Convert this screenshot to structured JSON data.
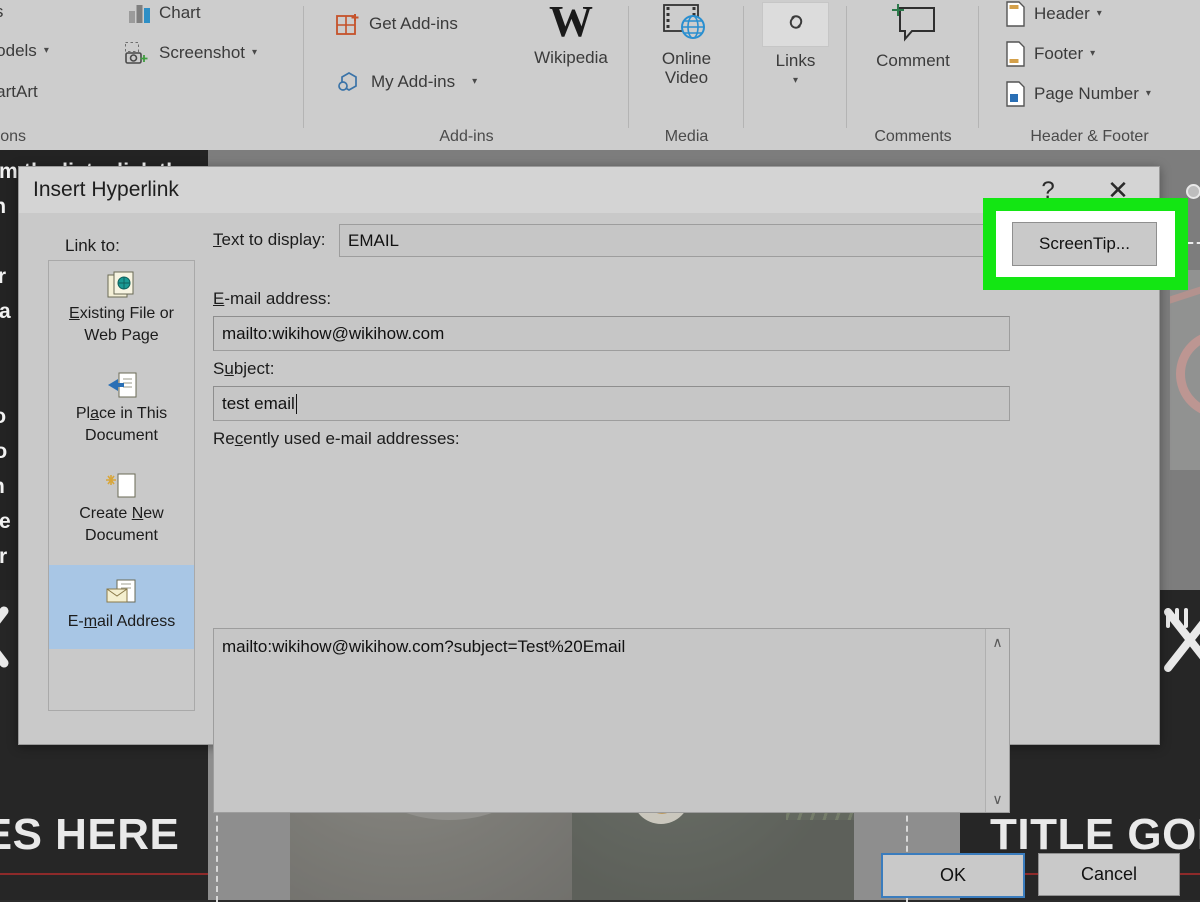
{
  "ribbon": {
    "groups": [
      {
        "name": "illustrations",
        "label": "rations"
      },
      {
        "name": "add-ins",
        "label": "Add-ins"
      },
      {
        "name": "media",
        "label": "Media"
      },
      {
        "name": "links",
        "label": ""
      },
      {
        "name": "comments",
        "label": "Comments"
      },
      {
        "name": "header-footer",
        "label": "Header & Footer"
      }
    ],
    "illustrations": {
      "icons_label": "ons",
      "models_label": "Models",
      "smartart_label": "martArt",
      "chart_label": "Chart",
      "screenshot_label": "Screenshot"
    },
    "addins": {
      "get_addins_label": "Get Add-ins",
      "my_addins_label": "My Add-ins",
      "wikipedia_label": "Wikipedia",
      "wikipedia_glyph": "W"
    },
    "media": {
      "online_video_line1": "Online",
      "online_video_line2": "Video"
    },
    "links": {
      "links_label": "Links"
    },
    "comments": {
      "comment_label": "Comment"
    },
    "header_footer": {
      "header_label": "Header",
      "footer_label": "Footer",
      "page_number_label": "Page Number"
    }
  },
  "background": {
    "instruction_text": "om the list, click the\nth\nli\ner\nna\n\nu\nfo\nro\nin\nhe\nor",
    "slide_left_title": "OES HERE",
    "slide_right_title": "TITLE GOE"
  },
  "dialog": {
    "title": "Insert Hyperlink",
    "help_glyph": "?",
    "close_glyph": "✕",
    "link_to_label": "Link to:",
    "sidebar_items": [
      {
        "label_line1": "Existing File or",
        "label_line2": "Web Page",
        "icon": "existing-file-icon",
        "selected": false
      },
      {
        "label_line1": "Place in This",
        "label_line2": "Document",
        "icon": "place-in-document-icon",
        "selected": false
      },
      {
        "label_line1": "Create New",
        "label_line2": "Document",
        "icon": "create-new-document-icon",
        "selected": false
      },
      {
        "label_line1": "E-mail Address",
        "label_line2": "",
        "icon": "email-address-icon",
        "selected": true
      }
    ],
    "text_to_display_label": "Text to display:",
    "text_to_display_value": "EMAIL",
    "email_address_label": "E-mail address:",
    "email_address_value": "mailto:wikihow@wikihow.com",
    "subject_label": "Subject:",
    "subject_value": "test email",
    "recent_label": "Recently used e-mail addresses:",
    "recent_items": [
      "mailto:wikihow@wikihow.com?subject=Test%20Email"
    ],
    "screentip_label": "ScreenTip...",
    "ok_label": "OK",
    "cancel_label": "Cancel",
    "scroll_up_glyph": "∧",
    "scroll_down_glyph": "∨"
  },
  "colors": {
    "highlight": "#13e613",
    "dialog_bg": "#c9c9c9",
    "titlebar_bg": "#d4d4d4",
    "selected_item_bg": "#a8c6e5",
    "focus_border": "#3a7cbd",
    "ribbon_bg": "#cdcdcd",
    "slide_bg": "#7d7d7d",
    "panel_dark": "#262626"
  }
}
